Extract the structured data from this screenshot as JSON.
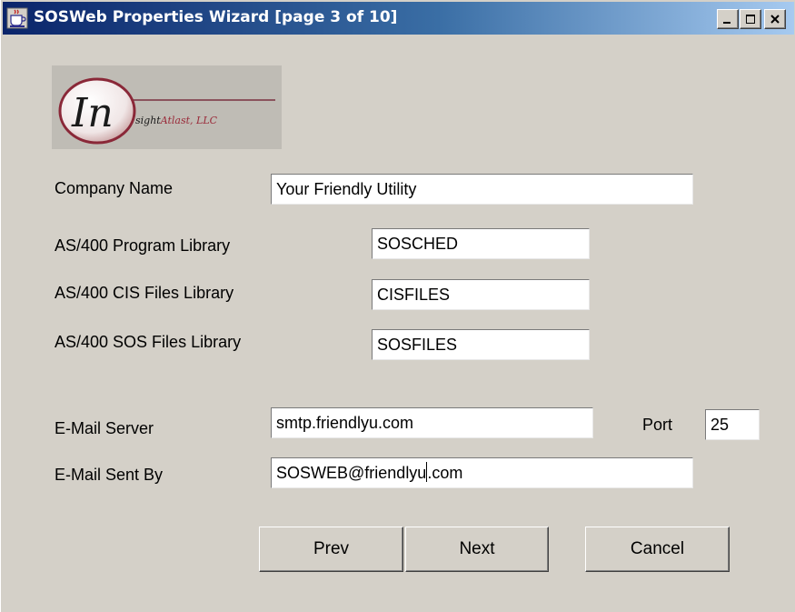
{
  "window": {
    "title": "SOSWeb Properties Wizard  [page 3 of 10]",
    "icon": "java-cup-icon",
    "controls": {
      "minimize": "_",
      "maximize": "□",
      "close": "✕"
    }
  },
  "logo": {
    "big": "In",
    "company": "sightAtlast, LLC",
    "company_a": "sight",
    "company_b": "Atlast, LLC"
  },
  "form": {
    "company_name": {
      "label": "Company Name",
      "value": "Your Friendly Utility"
    },
    "program_library": {
      "label": "AS/400 Program Library",
      "value": "SOSCHED"
    },
    "cis_library": {
      "label": "AS/400 CIS Files Library",
      "value": "CISFILES"
    },
    "sos_library": {
      "label": "AS/400 SOS Files Library",
      "value": "SOSFILES"
    },
    "mail_server": {
      "label": "E-Mail Server",
      "value": "smtp.friendlyu.com"
    },
    "port": {
      "label": "Port",
      "value": "25"
    },
    "mail_sent_by": {
      "label": "E-Mail Sent By",
      "value_before_caret": "SOSWEB@friendlyu",
      "value_after_caret": ".com"
    }
  },
  "buttons": {
    "prev": "Prev",
    "next": "Next",
    "cancel": "Cancel"
  }
}
